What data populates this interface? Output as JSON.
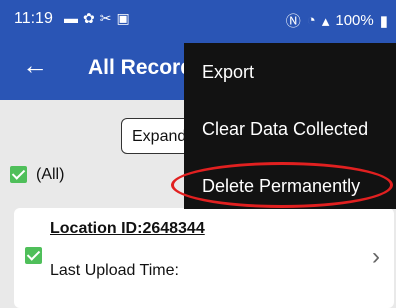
{
  "status_bar": {
    "time": "11:19",
    "battery": "100%",
    "icons_left": [
      "message-icon",
      "settings-icon",
      "tools-icon",
      "image-icon"
    ],
    "icons_right": [
      "nfc-icon",
      "wifi-icon",
      "signal-icon",
      "battery-icon"
    ]
  },
  "header": {
    "title": "All Record"
  },
  "toolbar": {
    "expand_label": "Expand"
  },
  "select_all": {
    "label": "(All)",
    "checked": true
  },
  "record": {
    "location": "Location ID:2648344",
    "last_upload": "Last Upload Time:",
    "checked": true
  },
  "menu": {
    "items": [
      "Export",
      "Clear Data Collected",
      "Delete Permanently"
    ]
  },
  "colors": {
    "header_bg": "#2a55b5",
    "menu_bg": "#121212",
    "checkbox": "#4fbf5a",
    "annotation": "#e12020"
  }
}
